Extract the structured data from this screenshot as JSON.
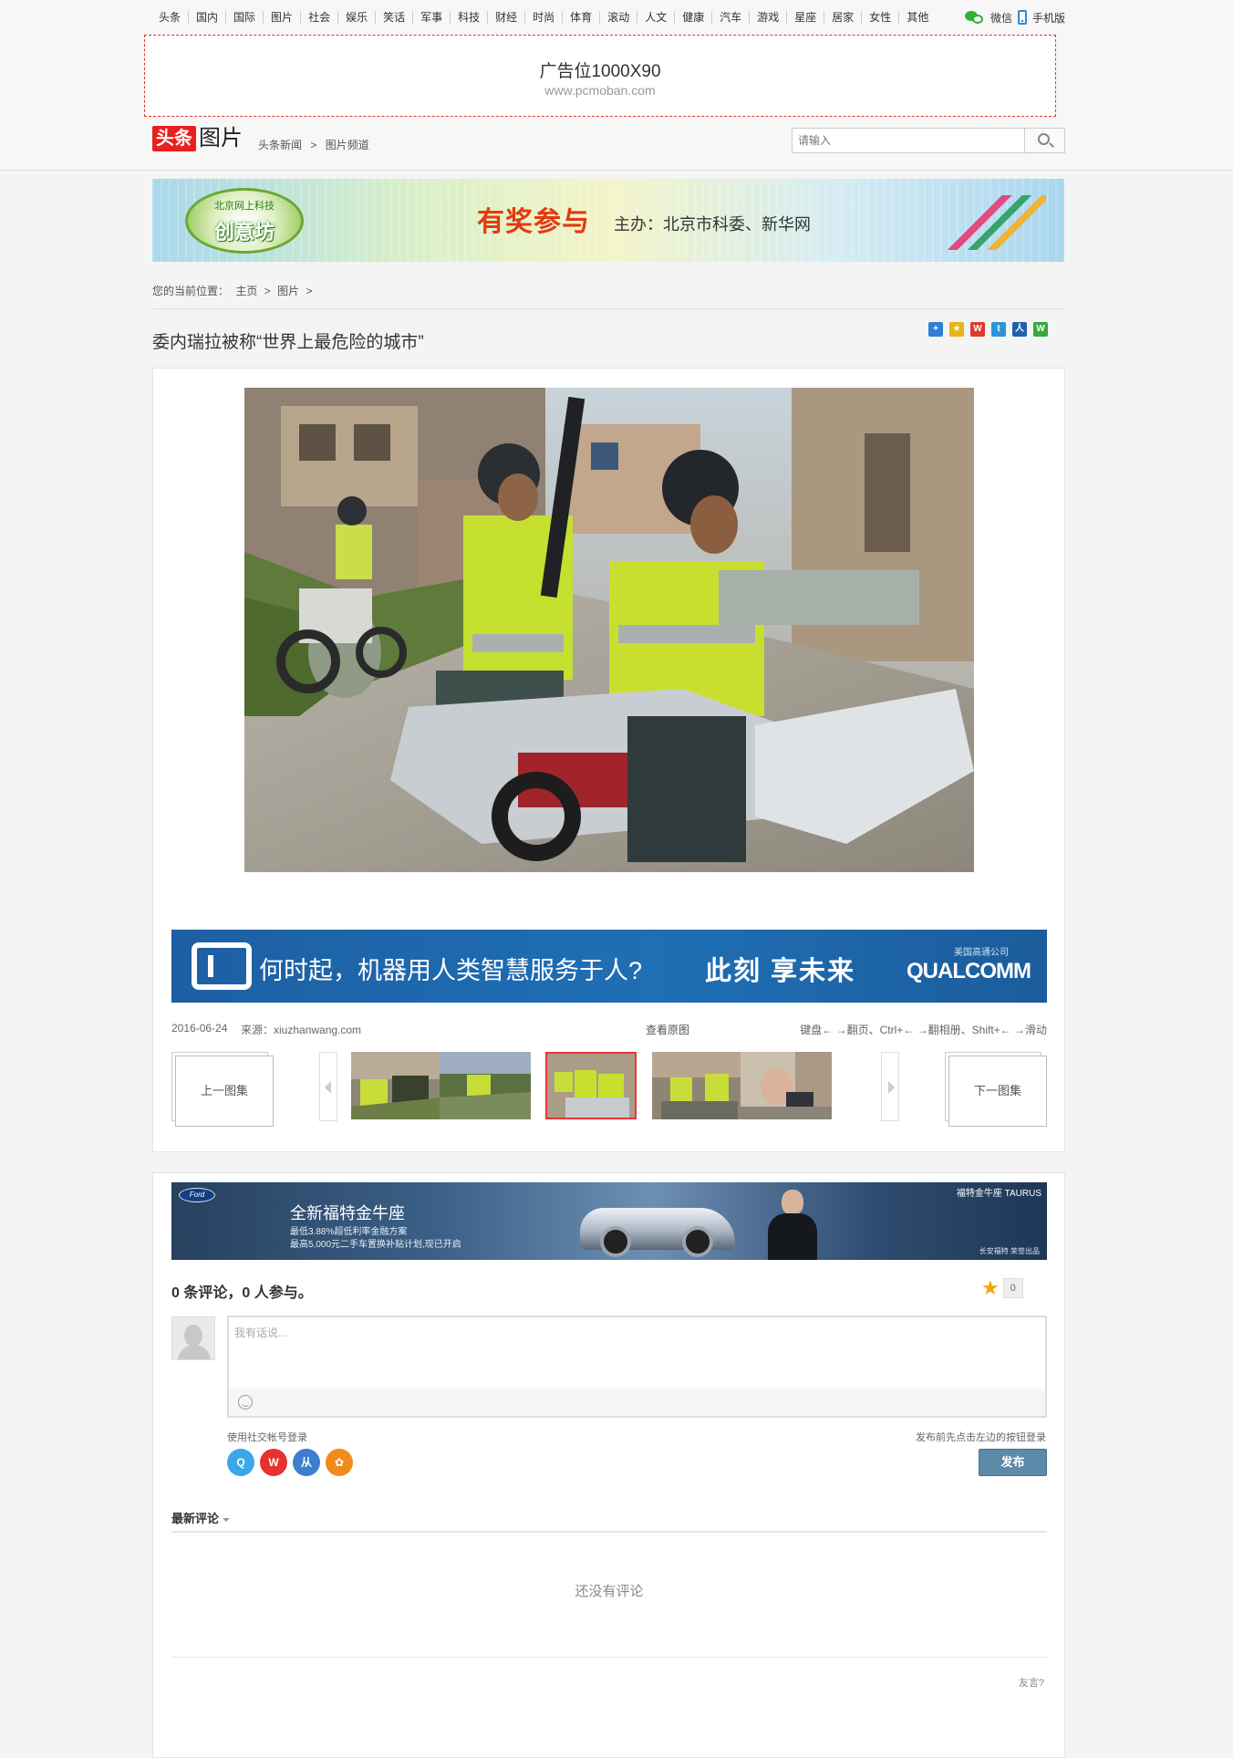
{
  "topnav": [
    "头条",
    "国内",
    "国际",
    "图片",
    "社会",
    "娱乐",
    "笑话",
    "军事",
    "科技",
    "财经",
    "时尚",
    "体育",
    "滚动",
    "人文",
    "健康",
    "汽车",
    "游戏",
    "星座",
    "居家",
    "女性",
    "其他"
  ],
  "toplinks": {
    "wechat": "微信",
    "mobile": "手机版"
  },
  "ad_top": {
    "title": "广告位1000X90",
    "url": "www.pcmoban.com"
  },
  "logo": {
    "red": "头条",
    "text": "图片"
  },
  "crumb_top": [
    "头条新闻",
    ">",
    "图片频道"
  ],
  "search": {
    "placeholder": "请输入"
  },
  "banner_mid": {
    "badge_small": "北京网上科技",
    "badge": "创意坊",
    "headline": "有奖参与",
    "sub": "主办：北京市科委、新华网"
  },
  "location": {
    "label": "您的当前位置：",
    "home": "主页",
    "sep1": ">",
    "section": "图片",
    "sep2": ">"
  },
  "article": {
    "title": "委内瑞拉被称“世界上最危险的城市”"
  },
  "share": [
    {
      "name": "plus-share-icon",
      "glyph": "+",
      "color": "#2d7fd6"
    },
    {
      "name": "qzone-share-icon",
      "glyph": "★",
      "color": "#e9b31b"
    },
    {
      "name": "weibo-share-icon",
      "glyph": "W",
      "color": "#e0382e"
    },
    {
      "name": "tencent-weibo-share-icon",
      "glyph": "t",
      "color": "#2a94d8"
    },
    {
      "name": "renren-share-icon",
      "glyph": "人",
      "color": "#1f5fae"
    },
    {
      "name": "wechat-share-icon",
      "glyph": "W",
      "color": "#3aa742"
    }
  ],
  "ad_qualcomm": {
    "question": "何时起，机器用人类智慧服务于人?",
    "slogan": "此刻 享未来",
    "brand": "QUALCOMM",
    "brand_sub": "美国高通公司"
  },
  "meta": {
    "date": "2016-06-24",
    "source": "来源：xiuzhanwang.com",
    "original": "查看原图",
    "hint": "键盘← →翻页、Ctrl+← →翻相册、Shift+← →滑动"
  },
  "gallery": {
    "prev_set": "上一图集",
    "next_set": "下一图集",
    "active_index": 2,
    "thumb_count": 5
  },
  "ad_ford": {
    "logo": "Ford",
    "headline": "全新福特金牛座",
    "line1": "最低3.88%超低利率金融方案",
    "line2": "最高5,000元二手车置换补贴计划,现已开启",
    "tag": "福特金牛座 TAURUS",
    "foot": "长安福特 荣誉出品"
  },
  "comments": {
    "count_text": "0 条评论，0 人参与。",
    "star_count": "0",
    "placeholder": "我有话说...",
    "social_label": "使用社交帐号登录",
    "social": [
      {
        "name": "qq-login-icon",
        "glyph": "Q",
        "color": "#3aa7e6"
      },
      {
        "name": "weibo-login-icon",
        "glyph": "W",
        "color": "#e6312e"
      },
      {
        "name": "renren-login-icon",
        "glyph": "从",
        "color": "#3d7fcc"
      },
      {
        "name": "kaixin-login-icon",
        "glyph": "✿",
        "color": "#f28a1c"
      }
    ],
    "post_tip": "发布前先点击左边的按钮登录",
    "post_button": "发布",
    "latest_label": "最新评论",
    "empty_text": "还没有评论",
    "brand": "友言?"
  }
}
